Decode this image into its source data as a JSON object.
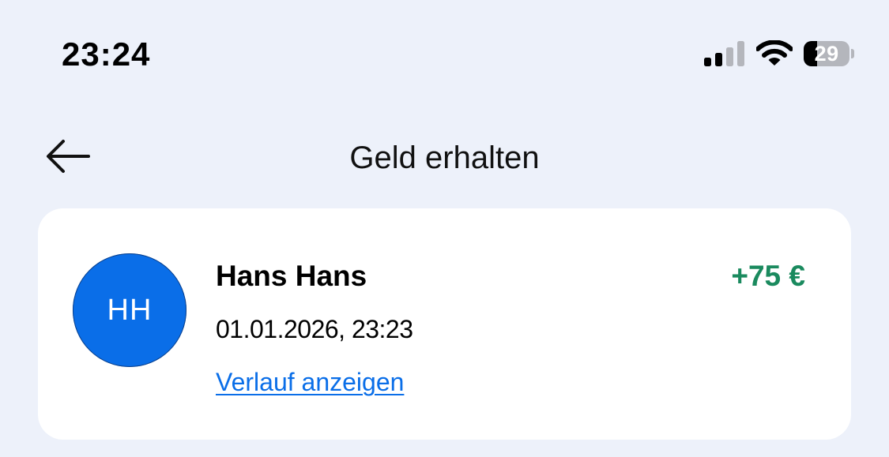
{
  "status_bar": {
    "time": "23:24",
    "signal_icon": "cellular-signal-icon",
    "signal_bars_active": 2,
    "signal_bars_total": 4,
    "wifi_icon": "wifi-icon",
    "battery_icon": "battery-icon",
    "battery_level": "29",
    "battery_fraction": 0.29
  },
  "header": {
    "back_icon": "arrow-left-icon",
    "title": "Geld erhalten"
  },
  "transaction": {
    "avatar_initials": "HH",
    "name": "Hans Hans",
    "amount": "+75 €",
    "date": "01.01.2026, 23:23",
    "history_link": "Verlauf anzeigen"
  },
  "colors": {
    "background": "#edf1fa",
    "card": "#ffffff",
    "avatar": "#0a6ee8",
    "link": "#0a6ee8",
    "amount_positive": "#1a8a5e"
  }
}
